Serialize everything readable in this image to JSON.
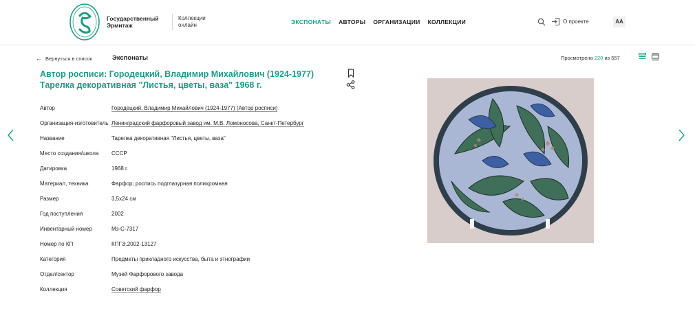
{
  "header": {
    "museum_name_line1": "Государственный",
    "museum_name_line2": "Эрмитаж",
    "collections_line1": "Коллекции",
    "collections_line2": "онлайн",
    "nav": [
      {
        "label": "ЭКСПОНАТЫ",
        "active": true
      },
      {
        "label": "АВТОРЫ",
        "active": false
      },
      {
        "label": "ОРГАНИЗАЦИИ",
        "active": false
      },
      {
        "label": "КОЛЛЕКЦИИ",
        "active": false
      }
    ],
    "about_label": "О проекте",
    "font_toggle_label": "AA"
  },
  "toolbar": {
    "back_label": "Вернуться в список",
    "section_label": "Экспонаты",
    "viewed_prefix": "Просмотрено",
    "viewed_count": "220",
    "viewed_sep": "из",
    "viewed_total": "557"
  },
  "item": {
    "title_line1": "Автор росписи: Городецкий, Владимир Михайлович (1924-1977)",
    "title_line2": "Тарелка декоративная \"Листья, цветы, ваза\" 1968 г.",
    "properties": [
      {
        "label": "Автор",
        "value": "Городецкий, Владимир Михайлович (1924-1977) (Автор росписи)",
        "link": true
      },
      {
        "label": "Организация-изготовитель",
        "value": "Ленинградский фарфоровый завод им. М.В. Ломоносова, Санкт-Петербург",
        "link": true
      },
      {
        "label": "Название",
        "value": "Тарелка декоративная \"Листья, цветы, ваза\"",
        "link": false
      },
      {
        "label": "Место создания/школа",
        "value": "СССР",
        "link": false
      },
      {
        "label": "Датировка",
        "value": "1968 г.",
        "link": false
      },
      {
        "label": "Материал, техника",
        "value": "Фарфор; роспись подглазурная полихромная",
        "link": false
      },
      {
        "label": "Размер",
        "value": "3,5х24 см",
        "link": false
      },
      {
        "label": "Год поступления",
        "value": "2002",
        "link": false
      },
      {
        "label": "Инвентарный номер",
        "value": "Мз-С-7317",
        "link": false
      },
      {
        "label": "Номер по КП",
        "value": "КПГЭ.2002-13127",
        "link": false
      },
      {
        "label": "Категория",
        "value": "Предметы прикладного искусства, быта и этнографии",
        "link": false
      },
      {
        "label": "Отдел/сектор",
        "value": "Музей Фарфорового завода",
        "link": false
      },
      {
        "label": "Коллекция",
        "value": "Советский фарфор",
        "link": true
      }
    ]
  },
  "colors": {
    "accent": "#1f9a86",
    "plate_blue": "#3d5fa3",
    "plate_green": "#3f6e59",
    "background_photo": "#d9cdcc"
  },
  "icons": {
    "search": "search-icon",
    "login": "login-icon",
    "bookmark": "bookmark-icon",
    "share": "share-icon",
    "prev": "chevron-left-icon",
    "next": "chevron-right-icon"
  }
}
